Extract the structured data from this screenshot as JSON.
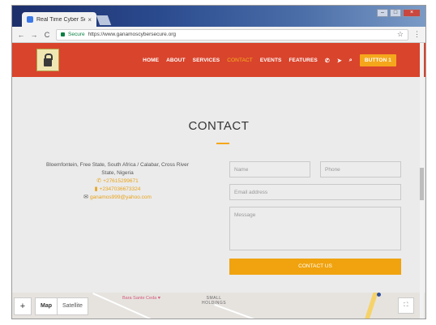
{
  "browser": {
    "tab_title": "Real Time Cyber Securit",
    "tab_close": "×",
    "secure_label": "Secure",
    "url": "https://www.ganamoscybersecure.org"
  },
  "header": {
    "logo_alt": "site-logo",
    "nav": {
      "home": "HOME",
      "about": "ABOUT",
      "services": "SERVICES",
      "contact": "CONTACT",
      "events": "EVENTS",
      "features": "FEATURES",
      "button1": "BUTTON 1"
    },
    "colors": {
      "header_bg": "#d9442c",
      "accent": "#f5a71c"
    }
  },
  "contact": {
    "title": "CONTACT",
    "address": "Bloemfontein, Free State, South Africa / Calabar, Cross River State, Nigeria",
    "phone1": "+27615299671",
    "phone2": "+2347036673324",
    "email": "ganamos999@yahoo.com",
    "form": {
      "name_placeholder": "Name",
      "phone_placeholder": "Phone",
      "email_placeholder": "Email address",
      "message_placeholder": "Message",
      "submit_label": "CONTACT US"
    }
  },
  "map": {
    "zoom_in": "+",
    "map_tab": "Map",
    "satellite_tab": "Satellite",
    "poi_label": "Bara Sante Ceda",
    "area_label_1": "SMALL",
    "area_label_2": "HOLDINGS"
  }
}
